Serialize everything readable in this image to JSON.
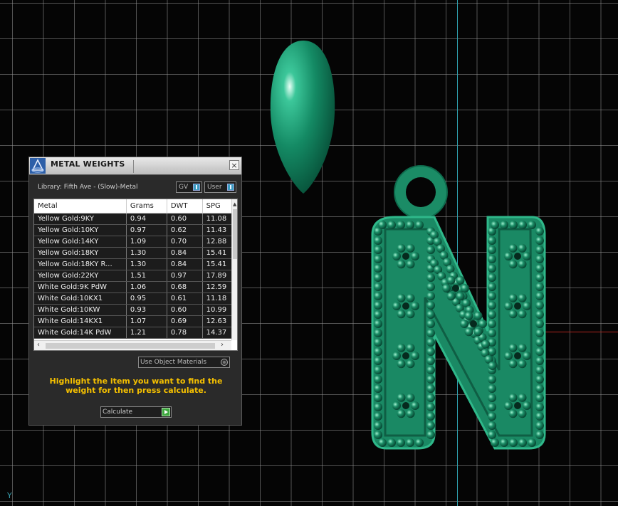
{
  "viewport": {
    "axis_corner_label": "Y",
    "colors": {
      "grid": "#969696",
      "axis_vertical": "#2fa3b0",
      "axis_horizontal": "#b0251e",
      "model": "#1f8c6c"
    }
  },
  "panel": {
    "title": "METAL WEIGHTS",
    "close_label": "×",
    "library": "Library: Fifth Ave - (Slow)-Metal",
    "toggles": {
      "gv": "GV",
      "user": "User"
    },
    "table": {
      "headers": [
        "Metal",
        "Grams",
        "DWT",
        "SPG"
      ],
      "rows": [
        [
          "Yellow Gold:9KY",
          "0.94",
          "0.60",
          "11.08"
        ],
        [
          "Yellow Gold:10KY",
          "0.97",
          "0.62",
          "11.43"
        ],
        [
          "Yellow Gold:14KY",
          "1.09",
          "0.70",
          "12.88"
        ],
        [
          "Yellow Gold:18KY",
          "1.30",
          "0.84",
          "15.41"
        ],
        [
          "Yellow Gold:18KY R...",
          "1.30",
          "0.84",
          "15.41"
        ],
        [
          "Yellow Gold:22KY",
          "1.51",
          "0.97",
          "17.89"
        ],
        [
          "White Gold:9K PdW",
          "1.06",
          "0.68",
          "12.59"
        ],
        [
          "White Gold:10KX1",
          "0.95",
          "0.61",
          "11.18"
        ],
        [
          "White Gold:10KW",
          "0.93",
          "0.60",
          "10.99"
        ],
        [
          "White Gold:14KX1",
          "1.07",
          "0.69",
          "12.63"
        ],
        [
          "White Gold:14K PdW",
          "1.21",
          "0.78",
          "14.37"
        ]
      ]
    },
    "use_object_materials": "Use Object Materials",
    "instruction": "Highlight the item you want to find the weight for then press calculate.",
    "calculate_label": "Calculate",
    "accent_color": "#f5c000"
  }
}
